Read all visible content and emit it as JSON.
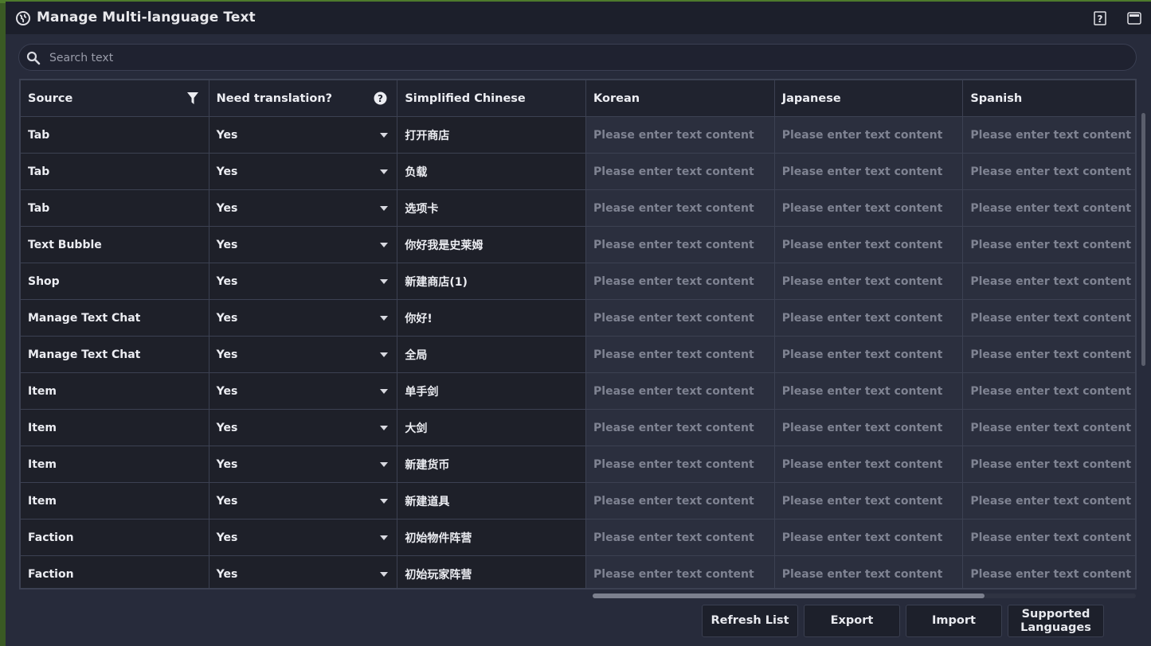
{
  "window": {
    "title": "Manage Multi-language Text"
  },
  "search": {
    "placeholder": "Search text"
  },
  "table": {
    "headers": [
      "Source",
      "Need translation?",
      "Simplified Chinese",
      "Korean",
      "Japanese",
      "Spanish"
    ],
    "lang_placeholder": "Please enter text content",
    "rows": [
      {
        "source": "Tab",
        "need": "Yes",
        "zh": "打开商店"
      },
      {
        "source": "Tab",
        "need": "Yes",
        "zh": "负载"
      },
      {
        "source": "Tab",
        "need": "Yes",
        "zh": "选项卡"
      },
      {
        "source": "Text Bubble",
        "need": "Yes",
        "zh": "你好我是史莱姆"
      },
      {
        "source": "Shop",
        "need": "Yes",
        "zh": "新建商店(1)"
      },
      {
        "source": "Manage Text Chat",
        "need": "Yes",
        "zh": "你好!"
      },
      {
        "source": "Manage Text Chat",
        "need": "Yes",
        "zh": "全局"
      },
      {
        "source": "Item",
        "need": "Yes",
        "zh": "单手剑"
      },
      {
        "source": "Item",
        "need": "Yes",
        "zh": "大剑"
      },
      {
        "source": "Item",
        "need": "Yes",
        "zh": "新建货币"
      },
      {
        "source": "Item",
        "need": "Yes",
        "zh": "新建道具"
      },
      {
        "source": "Faction",
        "need": "Yes",
        "zh": "初始物件阵营"
      },
      {
        "source": "Faction",
        "need": "Yes",
        "zh": "初始玩家阵营"
      }
    ]
  },
  "footer": {
    "refresh_label": "Refresh List",
    "export_label": "Export",
    "import_label": "Import",
    "supported_label_1": "Supported",
    "supported_label_2": "Languages"
  },
  "icons": {
    "title": "globe-icon",
    "help": "help-icon",
    "minimize": "minimize-icon",
    "search": "search-icon",
    "filter": "filter-icon",
    "question": "question-icon",
    "dropdown": "chevron-down-icon"
  },
  "colors": {
    "window_bg": "#272b3b",
    "titlebar": "#1c1f2b",
    "text": "#ecedf2",
    "placeholder": "#7f8392"
  }
}
